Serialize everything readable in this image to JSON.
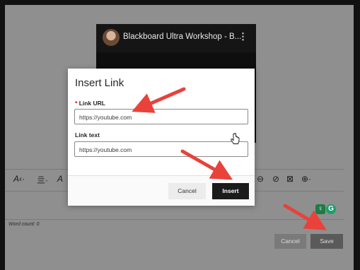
{
  "video": {
    "title": "Blackboard Ultra Workshop - B...",
    "menu_icon": "kebab-menu-icon"
  },
  "toolbar": {
    "items": [
      "A·",
      "亖·",
      "A",
      "⊖",
      "⊘",
      "⊠",
      "⊕·"
    ]
  },
  "editor": {
    "word_count": "Word count: 0",
    "cancel_label": "Cancel",
    "save_label": "Save"
  },
  "dialog": {
    "title": "Insert Link",
    "url_label": "Link URL",
    "url_required_marker": "*",
    "url_value": "https://youtube.com",
    "text_label": "Link text",
    "text_value": "https://youtube.com",
    "cancel_label": "Cancel",
    "insert_label": "Insert"
  },
  "colors": {
    "annotation_arrow": "#e8423a",
    "overlay": "#8f8f8f",
    "primary_button": "#1b1b1b"
  }
}
